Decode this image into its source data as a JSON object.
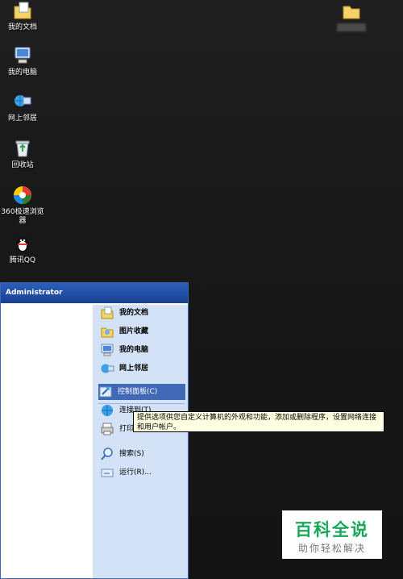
{
  "desktop": {
    "icons": [
      {
        "label": "我的文档",
        "icon": "my-documents-icon"
      },
      {
        "label": "我的电脑",
        "icon": "my-computer-icon"
      },
      {
        "label": "网上邻居",
        "icon": "network-places-icon"
      },
      {
        "label": "回收站",
        "icon": "recycle-bin-icon"
      },
      {
        "label": "360极速浏览器",
        "icon": "360-browser-icon"
      },
      {
        "label": "腾讯QQ",
        "icon": "qq-penguin-icon"
      },
      {
        "label": "",
        "icon": "folder-icon"
      }
    ]
  },
  "start_menu": {
    "user": "Administrator",
    "items": [
      {
        "label": "我的文档",
        "icon": "my-documents-icon"
      },
      {
        "label": "图片收藏",
        "icon": "my-pictures-icon"
      },
      {
        "label": "我的电脑",
        "icon": "my-computer-icon"
      },
      {
        "label": "网上邻居",
        "icon": "network-places-icon"
      },
      {
        "label": "控制面板(C)",
        "icon": "control-panel-icon"
      },
      {
        "label": "连接到(T)",
        "icon": "connect-to-icon"
      },
      {
        "label": "打印",
        "icon": "printer-icon"
      },
      {
        "label": "搜索(S)",
        "icon": "search-icon"
      },
      {
        "label": "运行(R)...",
        "icon": "run-icon"
      }
    ]
  },
  "tooltip": {
    "text": "提供选项供您自定义计算机的外观和功能，添加或删除程序，设置网络连接和用户帐户。"
  },
  "watermark": {
    "title": "百科全说",
    "subtitle": "助你轻松解决"
  },
  "colors": {
    "selection": "#4169b6",
    "menu_header": "#2e5fb8",
    "menu_right_pane": "#d3e2f7",
    "tooltip_bg": "#ffffe1",
    "watermark_green": "#18a85a"
  }
}
